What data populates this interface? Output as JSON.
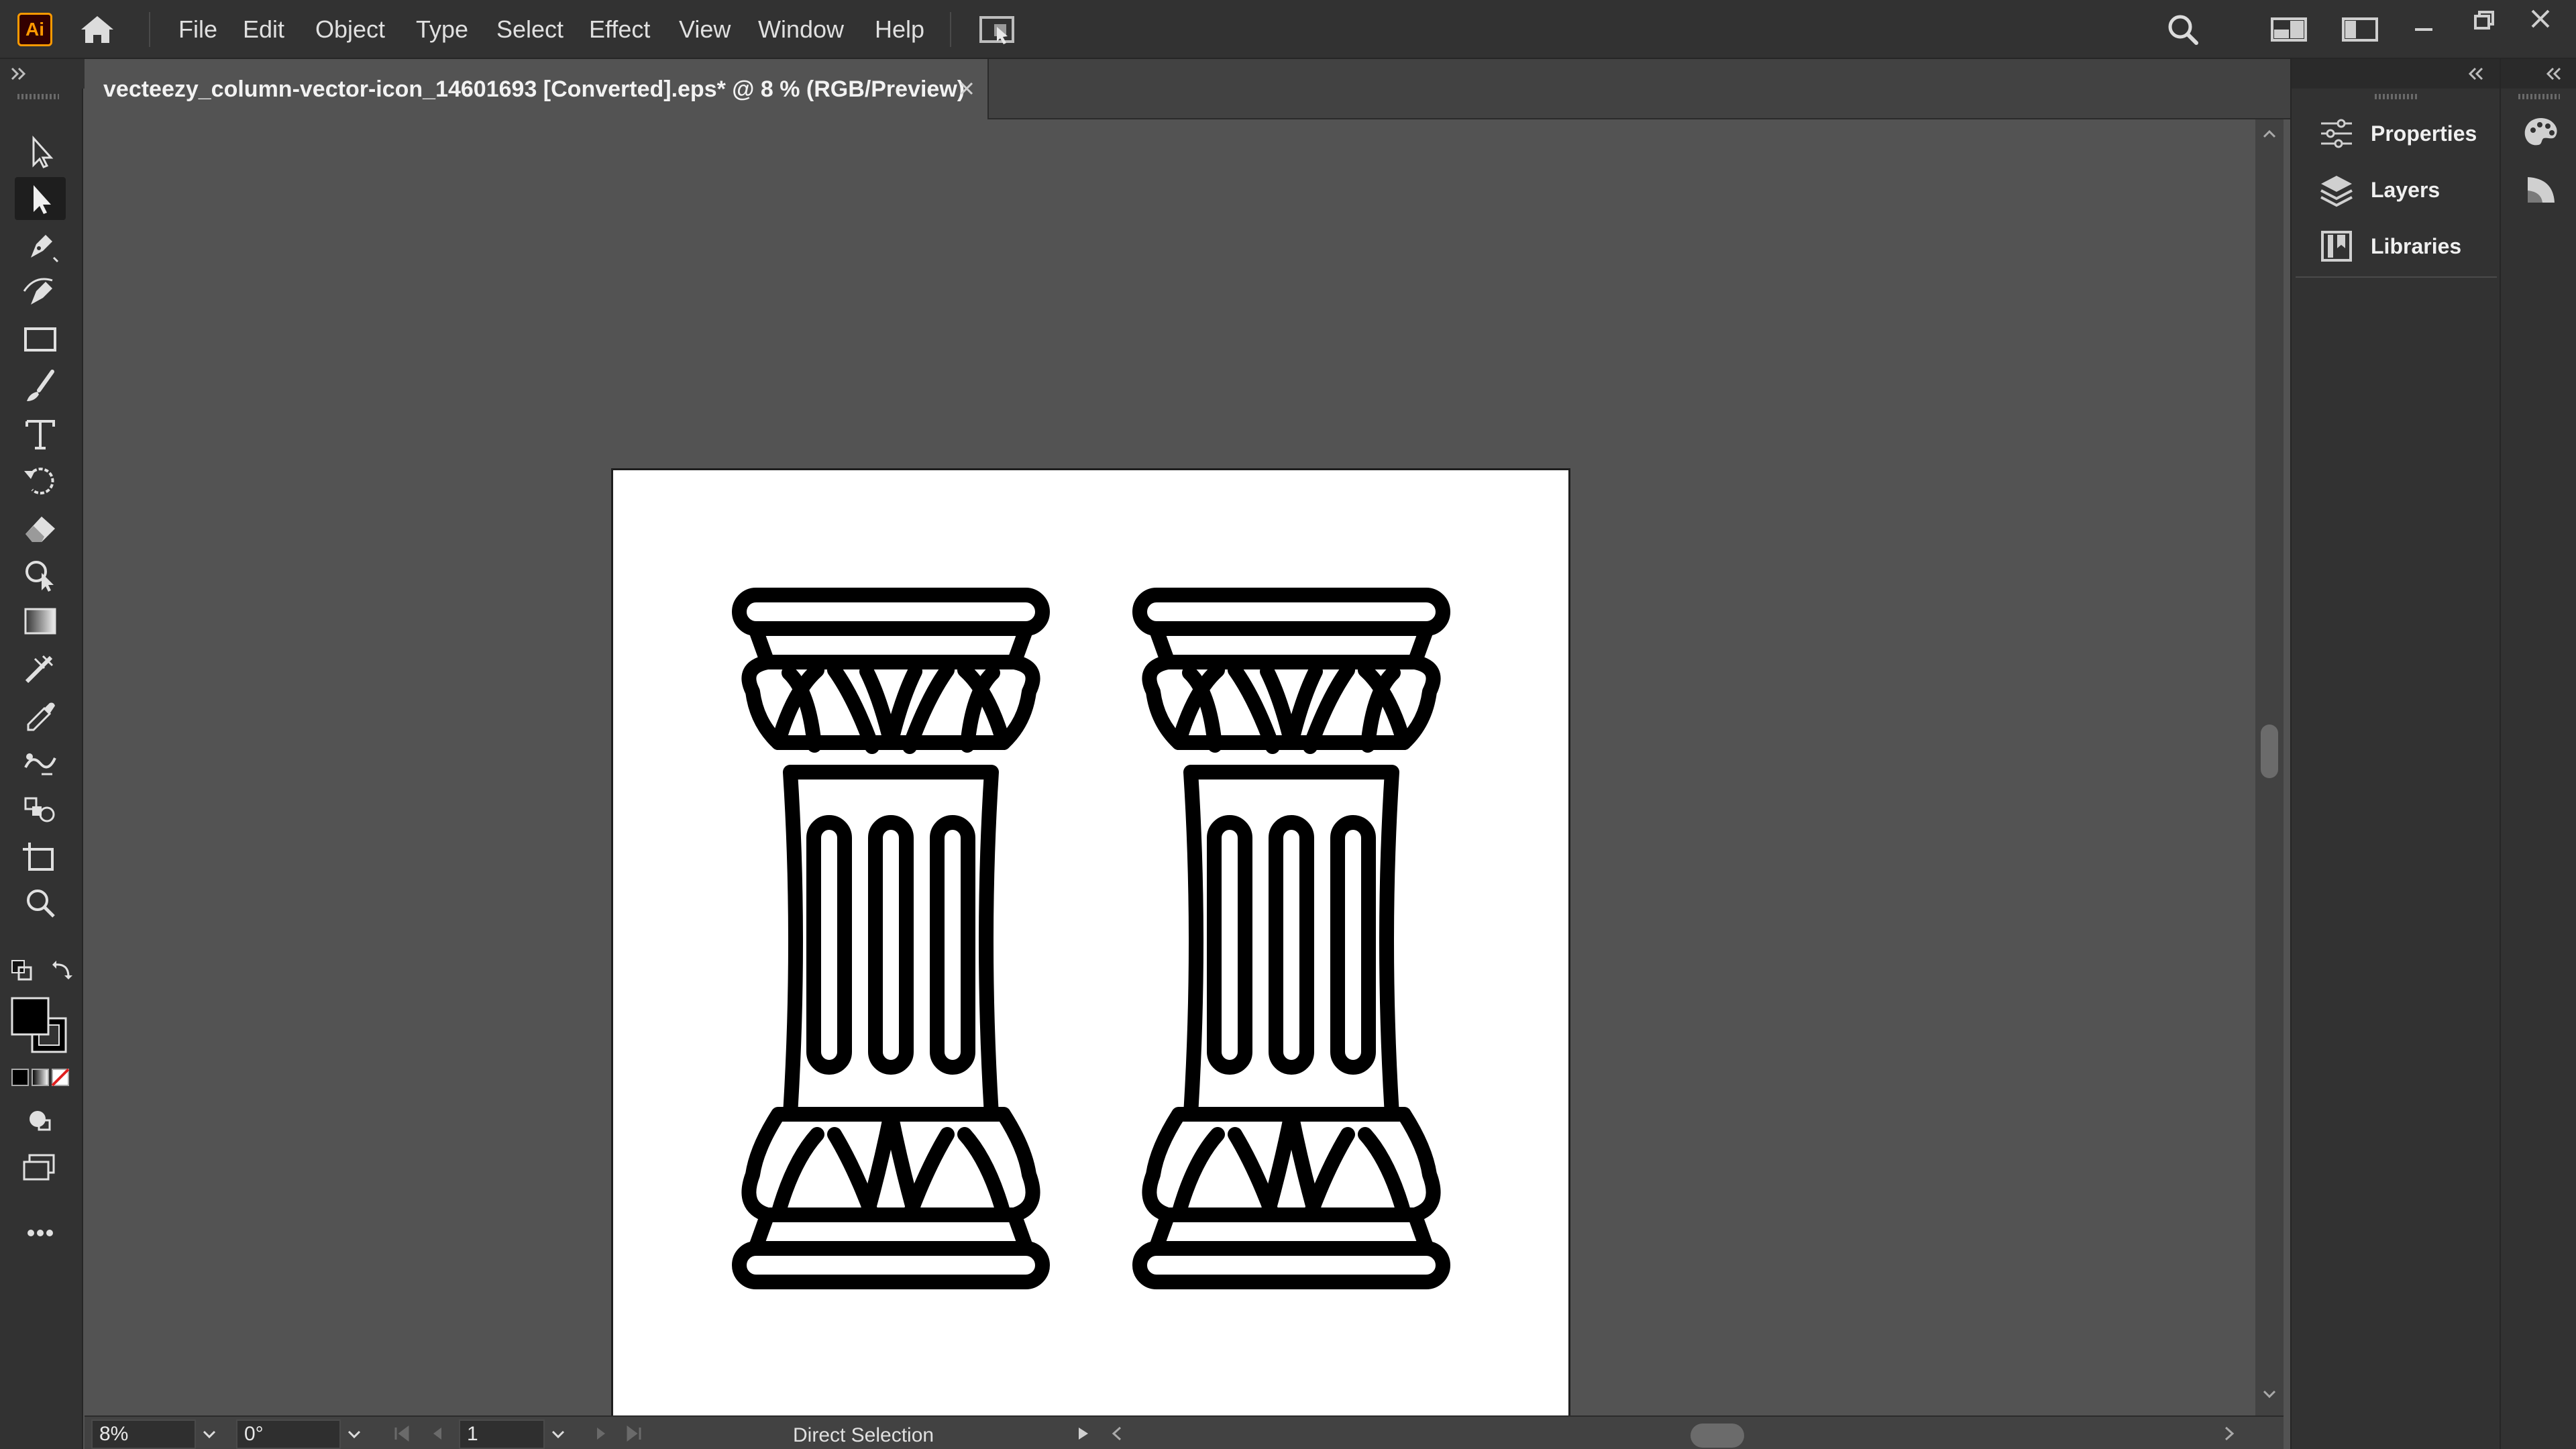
{
  "app": {
    "logo_text": "Ai",
    "menu": [
      "File",
      "Edit",
      "Object",
      "Type",
      "Select",
      "Effect",
      "View",
      "Window",
      "Help"
    ]
  },
  "document": {
    "tab_title": "vecteezy_column-vector-icon_14601693 [Converted].eps* @ 8 % (RGB/Preview)"
  },
  "toolbar": {
    "tools": [
      "selection",
      "direct-selection",
      "pen",
      "curvature",
      "rectangle",
      "paintbrush",
      "type",
      "rotate",
      "eraser",
      "shape-builder",
      "gradient",
      "width",
      "eyedropper",
      "puppet-warp",
      "symbol-sprayer",
      "artboard",
      "zoom"
    ],
    "active_tool": "direct-selection",
    "fill_color": "#000000",
    "stroke_color": "#000000"
  },
  "panels": {
    "items": [
      "Properties",
      "Layers",
      "Libraries"
    ]
  },
  "statusbar": {
    "zoom": "8%",
    "rotation": "0°",
    "artboard_number": "1",
    "current_tool": "Direct Selection"
  },
  "colors": {
    "menubar": "#323232",
    "canvas": "#535353",
    "logo_accent": "#ff9a00",
    "artboard": "#ffffff"
  }
}
